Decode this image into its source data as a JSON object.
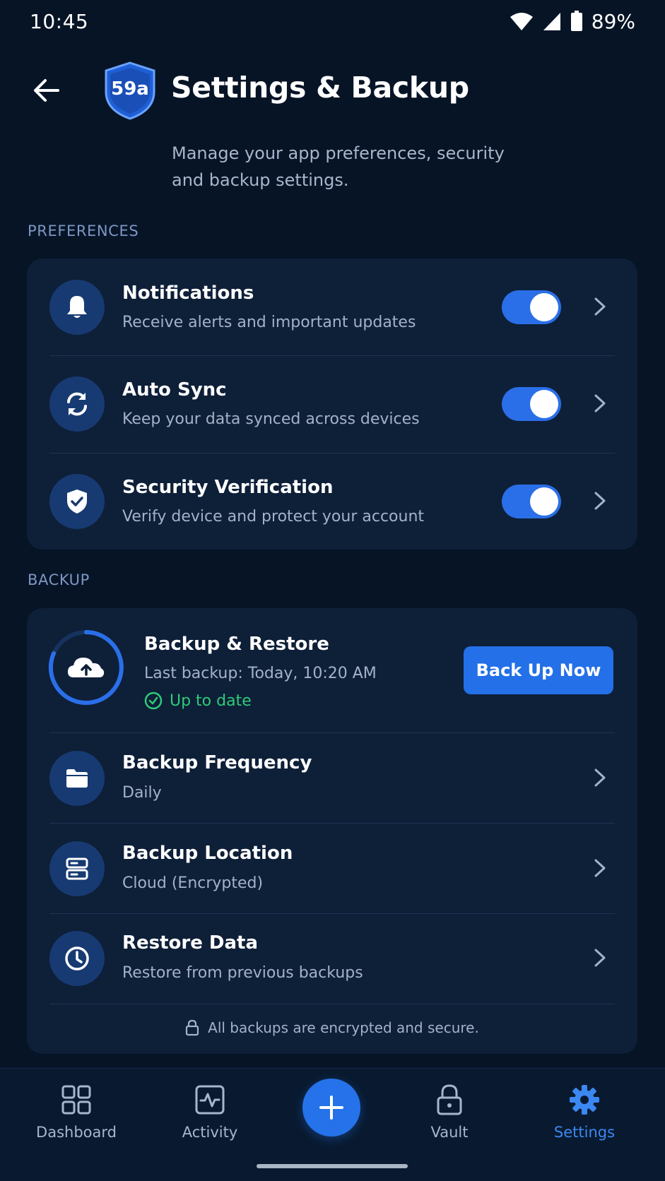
{
  "status_bar": {
    "time": "10:45",
    "battery": "89%",
    "icons": [
      "wifi-icon",
      "signal-icon",
      "battery-icon"
    ]
  },
  "header": {
    "logo_text": "59a",
    "title": "Settings & Backup",
    "subtitle": "Manage your app preferences, security and backup settings."
  },
  "preferences": {
    "label": "PREFERENCES",
    "items": [
      {
        "icon": "bell-icon",
        "title": "Notifications",
        "subtitle": "Receive alerts and important updates",
        "enabled": true
      },
      {
        "icon": "sync-icon",
        "title": "Auto Sync",
        "subtitle": "Keep your data synced across devices",
        "enabled": true
      },
      {
        "icon": "shield-check-icon",
        "title": "Security Verification",
        "subtitle": "Verify device and protect your account",
        "enabled": true
      }
    ]
  },
  "backup": {
    "label": "BACKUP",
    "status": {
      "title": "Backup & Restore",
      "last_backup": "Last backup: Today, 10:20 AM",
      "state": "Up to date",
      "button": "Back Up Now"
    },
    "items": [
      {
        "icon": "folder-icon",
        "title": "Backup Frequency",
        "subtitle": "Daily"
      },
      {
        "icon": "server-icon",
        "title": "Backup Location",
        "subtitle": "Cloud (Encrypted)"
      },
      {
        "icon": "clock-icon",
        "title": "Restore Data",
        "subtitle": "Restore from previous backups"
      }
    ],
    "footer_note": "All backups are encrypted and secure."
  },
  "nav": {
    "items": [
      {
        "label": "Dashboard",
        "icon": "grid-icon",
        "active": false
      },
      {
        "label": "Activity",
        "icon": "activity-icon",
        "active": false
      },
      {
        "label": "Vault",
        "icon": "lock-icon",
        "active": false
      },
      {
        "label": "Settings",
        "icon": "gear-icon",
        "active": true
      }
    ],
    "fab_icon": "plus-icon"
  },
  "colors": {
    "background": "#071426",
    "card": "#0e1f38",
    "accent": "#2370e8",
    "success": "#2ecb76",
    "muted_text": "#a4b2c8"
  }
}
